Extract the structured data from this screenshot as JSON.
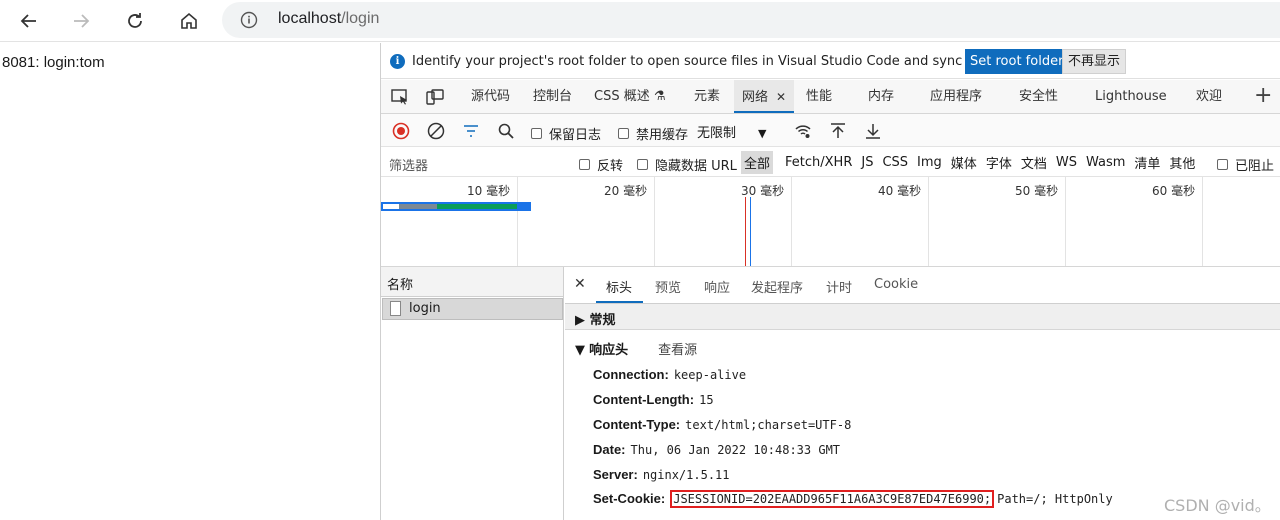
{
  "browser": {
    "url_host": "localhost",
    "url_path": "/login"
  },
  "page": {
    "text": "8081: login:tom"
  },
  "infobar": {
    "message": "Identify your project's root folder to open source files in Visual Studio Code and sync changes.",
    "primary_button": "Set root folder",
    "secondary_button": "不再显示"
  },
  "devtools_tabs": [
    {
      "label": "源代码"
    },
    {
      "label": "控制台"
    },
    {
      "label": "CSS 概述"
    },
    {
      "label": "元素"
    },
    {
      "label": "网络",
      "active": true
    },
    {
      "label": "性能"
    },
    {
      "label": "内存"
    },
    {
      "label": "应用程序"
    },
    {
      "label": "安全性"
    },
    {
      "label": "Lighthouse"
    },
    {
      "label": "欢迎"
    }
  ],
  "network_toolbar": {
    "preserve_log": "保留日志",
    "disable_cache": "禁用缓存",
    "throttling": "无限制"
  },
  "filter": {
    "placeholder": "筛选器",
    "invert": "反转",
    "hide_data_urls": "隐藏数据 URL",
    "types": [
      "全部",
      "Fetch/XHR",
      "JS",
      "CSS",
      "Img",
      "媒体",
      "字体",
      "文档",
      "WS",
      "Wasm",
      "清单",
      "其他"
    ],
    "blocked": "已阻止"
  },
  "timeline": {
    "ticks": [
      "10 毫秒",
      "20 毫秒",
      "30 毫秒",
      "40 毫秒",
      "50 毫秒",
      "60 毫秒"
    ]
  },
  "request_list": {
    "header": "名称",
    "rows": [
      "login"
    ]
  },
  "detail": {
    "tabs": [
      "标头",
      "预览",
      "响应",
      "发起程序",
      "计时",
      "Cookie"
    ],
    "general_section": "常规",
    "response_section": "响应头",
    "view_source": "查看源",
    "headers": [
      {
        "key": "Connection:",
        "value": "keep-alive"
      },
      {
        "key": "Content-Length:",
        "value": "15"
      },
      {
        "key": "Content-Type:",
        "value": "text/html;charset=UTF-8"
      },
      {
        "key": "Date:",
        "value": "Thu, 06 Jan 2022 10:48:33 GMT"
      },
      {
        "key": "Server:",
        "value": "nginx/1.5.11"
      }
    ],
    "set_cookie_key": "Set-Cookie:",
    "set_cookie_highlight": "JSESSIONID=202EAADD965F11A6A3C9E87ED47E6990;",
    "set_cookie_rest": "Path=/; HttpOnly"
  },
  "watermark": "CSDN @vid。",
  "colors": {
    "accent": "#0f6cbd",
    "highlight_border": "#e02020",
    "record_red": "#d93025"
  }
}
